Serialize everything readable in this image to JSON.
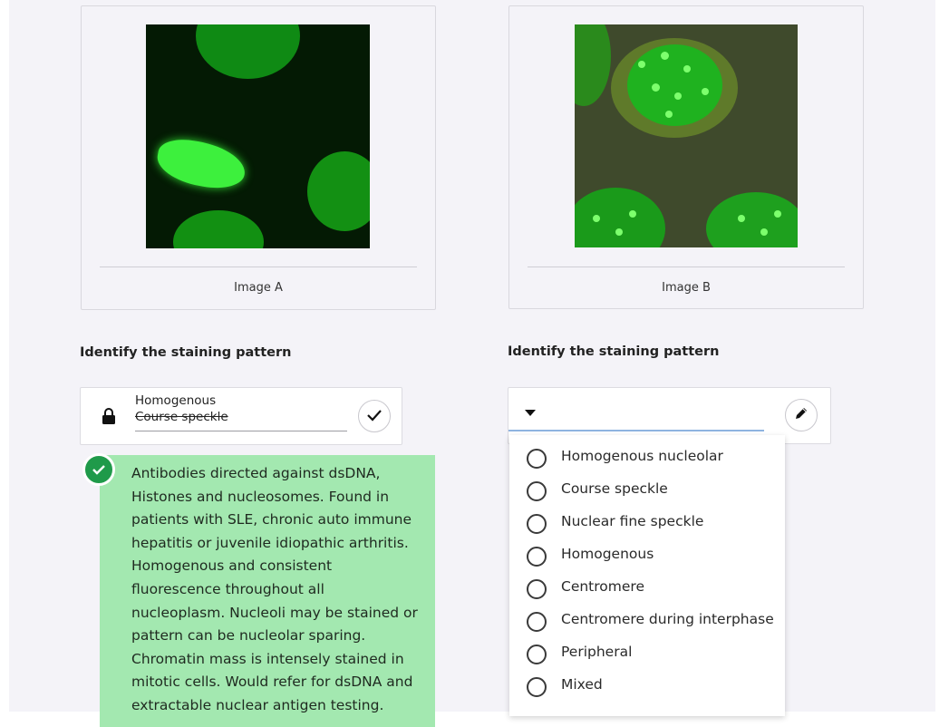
{
  "image_a": {
    "caption": "Image A"
  },
  "image_b": {
    "caption": "Image B"
  },
  "left_question": {
    "label": "Identify the staining pattern",
    "selected_value": "Homogenous",
    "struck_value": "Course speckle",
    "explanation": "Antibodies directed against dsDNA, Histones and nucleosomes. Found in patients with SLE, chronic auto immune hepatitis or juvenile idiopathic arthritis. Homogenous and consistent fluorescence throughout all nucleoplasm. Nucleoli may be stained or pattern can be nucleolar sparing. Chromatin mass is intensely stained in mitotic cells. Would refer for dsDNA and extractable nuclear antigen testing."
  },
  "right_question": {
    "label": "Identify the staining pattern",
    "selected_value": "",
    "options": [
      {
        "label": "Homogenous nucleolar"
      },
      {
        "label": "Course speckle"
      },
      {
        "label": "Nuclear fine speckle"
      },
      {
        "label": "Homogenous"
      },
      {
        "label": "Centromere"
      },
      {
        "label": "Centromere during interphase"
      },
      {
        "label": "Peripheral"
      },
      {
        "label": "Mixed"
      }
    ]
  },
  "colors": {
    "correct_bg": "#a3e8b0",
    "correct_badge": "#1f9a4a",
    "focus_underline": "#8fb4e0",
    "fluorescence": "#2ed62e"
  },
  "icons": {
    "lock": "lock-icon",
    "check": "check-icon",
    "pencil": "pencil-icon",
    "caret": "caret-down-icon",
    "correct": "check-circle-icon",
    "radio": "radio-unchecked-icon"
  }
}
